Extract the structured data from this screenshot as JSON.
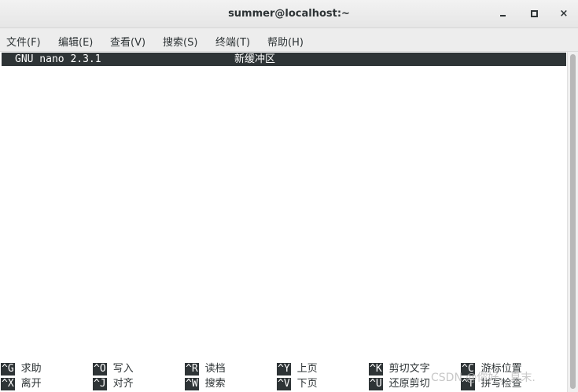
{
  "window": {
    "title": "summer@localhost:~",
    "minimize_icon": "minimize-icon",
    "maximize_icon": "maximize-icon",
    "close_icon": "close-icon",
    "close_glyph": "×"
  },
  "menubar": {
    "items": [
      {
        "label": "文件(F)"
      },
      {
        "label": "编辑(E)"
      },
      {
        "label": "查看(V)"
      },
      {
        "label": "搜索(S)"
      },
      {
        "label": "终端(T)"
      },
      {
        "label": "帮助(H)"
      }
    ]
  },
  "nano": {
    "version": "GNU nano 2.3.1",
    "filename": "新缓冲区",
    "shortcuts": [
      [
        {
          "key": "^G",
          "label": "求助"
        },
        {
          "key": "^O",
          "label": "写入"
        },
        {
          "key": "^R",
          "label": "读档"
        },
        {
          "key": "^Y",
          "label": "上页"
        },
        {
          "key": "^K",
          "label": "剪切文字"
        },
        {
          "key": "^C",
          "label": "游标位置"
        }
      ],
      [
        {
          "key": "^X",
          "label": "离开"
        },
        {
          "key": "^J",
          "label": "对齐"
        },
        {
          "key": "^W",
          "label": "搜索"
        },
        {
          "key": "^V",
          "label": "下页"
        },
        {
          "key": "^U",
          "label": "还原剪切"
        },
        {
          "key": "^T",
          "label": "拼写检查"
        }
      ]
    ]
  },
  "watermark": "CSDN @你好，夏末.",
  "colors": {
    "terminal_fg": "#2e3436",
    "terminal_bg": "#ffffff",
    "titlebar_bg": "#e8e8e8"
  }
}
